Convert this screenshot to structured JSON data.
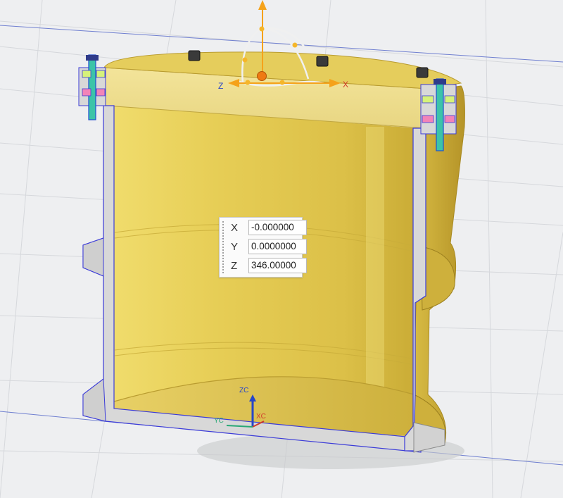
{
  "coordinates": {
    "x": {
      "label": "X",
      "value": "-0.000000"
    },
    "y": {
      "label": "Y",
      "value": "0.0000000"
    },
    "z": {
      "label": "Z",
      "value": "346.00000"
    }
  },
  "dynamic_handle": {
    "x_label": "X",
    "z_label": "Z"
  },
  "wcs_triad": {
    "zc_label": "ZC",
    "xc_label": "XC",
    "yc_label": "YC"
  },
  "colors": {
    "background": "#eeeff1",
    "grid": "#d6d8dc",
    "body_fill": "#e2c84e",
    "section_face": "#d9d9d9",
    "edge_highlight": "#3b3bd8",
    "x_axis": "#d23b2b",
    "z_axis": "#2746c8",
    "handle_orange": "#f5a21a"
  }
}
